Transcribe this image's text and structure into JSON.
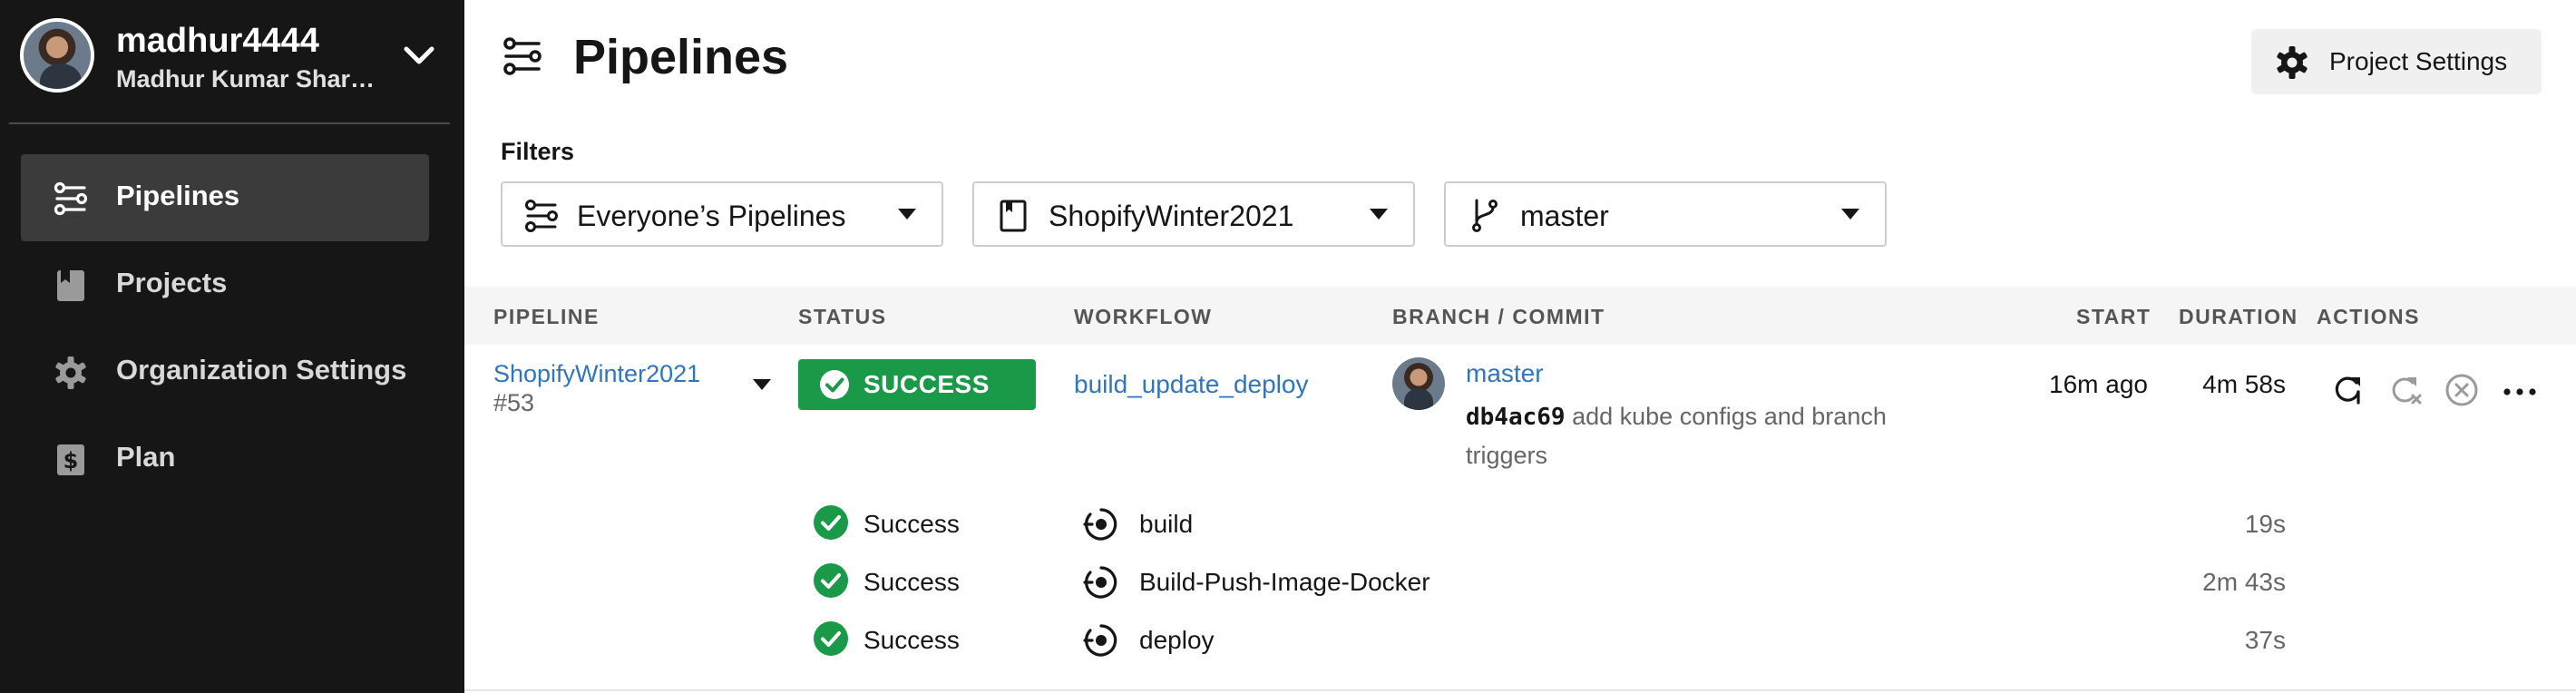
{
  "user": {
    "username": "madhur4444",
    "full_name": "Madhur Kumar Shar…"
  },
  "sidebar": {
    "items": [
      {
        "label": "Pipelines",
        "icon": "pipelines-icon",
        "active": true
      },
      {
        "label": "Projects",
        "icon": "book-icon",
        "active": false
      },
      {
        "label": "Organization Settings",
        "icon": "gear-icon",
        "active": false
      },
      {
        "label": "Plan",
        "icon": "dollar-plan-icon",
        "active": false
      }
    ]
  },
  "header": {
    "title": "Pipelines",
    "settings_button": "Project Settings"
  },
  "filters": {
    "label": "Filters",
    "pipelines": "Everyone’s Pipelines",
    "project": "ShopifyWinter2021",
    "branch": "master"
  },
  "table": {
    "headers": {
      "pipeline": "PIPELINE",
      "status": "STATUS",
      "workflow": "WORKFLOW",
      "branch_commit": "BRANCH / COMMIT",
      "start": "START",
      "duration": "DURATION",
      "actions": "ACTIONS"
    },
    "row": {
      "pipeline_name": "ShopifyWinter2021",
      "pipeline_number": "#53",
      "status": "SUCCESS",
      "workflow": "build_update_deploy",
      "branch": "master",
      "commit_hash": "db4ac69",
      "commit_message": "add kube configs and branch triggers",
      "start": "16m ago",
      "duration": "4m 58s"
    },
    "jobs": [
      {
        "status": "Success",
        "name": "build",
        "duration": "19s"
      },
      {
        "status": "Success",
        "name": "Build-Push-Image-Docker",
        "duration": "2m 43s"
      },
      {
        "status": "Success",
        "name": "deploy",
        "duration": "37s"
      }
    ]
  },
  "colors": {
    "sidebar_bg": "#161616",
    "link": "#2f75c0",
    "success": "#1a9a48"
  }
}
